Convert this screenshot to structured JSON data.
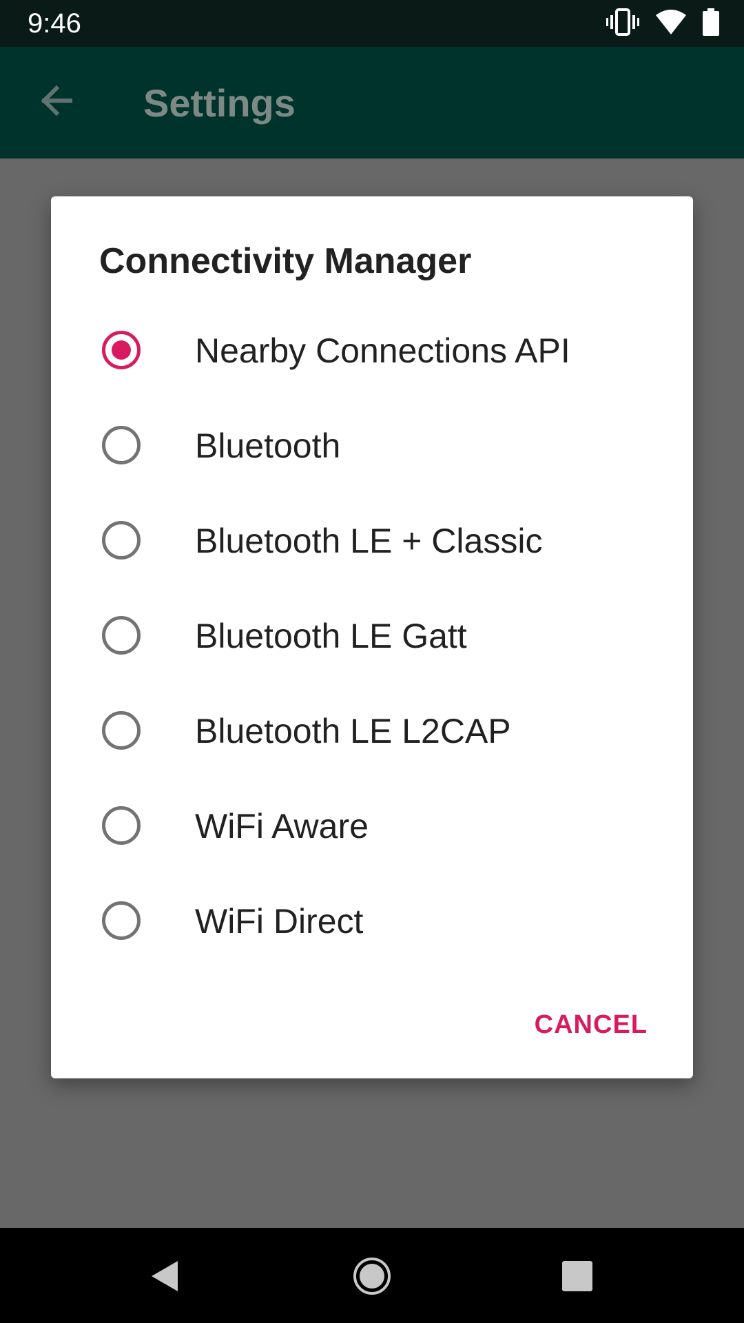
{
  "status_bar": {
    "time": "9:46",
    "icons": [
      "vibrate-icon",
      "wifi-icon",
      "battery-icon"
    ]
  },
  "app_bar": {
    "title": "Settings",
    "back_icon": "arrow-back-icon"
  },
  "dialog": {
    "title": "Connectivity Manager",
    "options": [
      {
        "label": "Nearby Connections API",
        "selected": true
      },
      {
        "label": "Bluetooth",
        "selected": false
      },
      {
        "label": "Bluetooth LE + Classic",
        "selected": false
      },
      {
        "label": "Bluetooth LE Gatt",
        "selected": false
      },
      {
        "label": "Bluetooth LE L2CAP",
        "selected": false
      },
      {
        "label": "WiFi Aware",
        "selected": false
      },
      {
        "label": "WiFi Direct",
        "selected": false
      }
    ],
    "cancel_label": "CANCEL"
  },
  "nav_bar": {
    "icons": [
      "back-triangle-icon",
      "home-circle-icon",
      "recents-square-icon"
    ]
  },
  "colors": {
    "accent": "#d81b60",
    "app_bar": "#00332c",
    "status_bar": "#091a17",
    "scrim": "#686868"
  }
}
